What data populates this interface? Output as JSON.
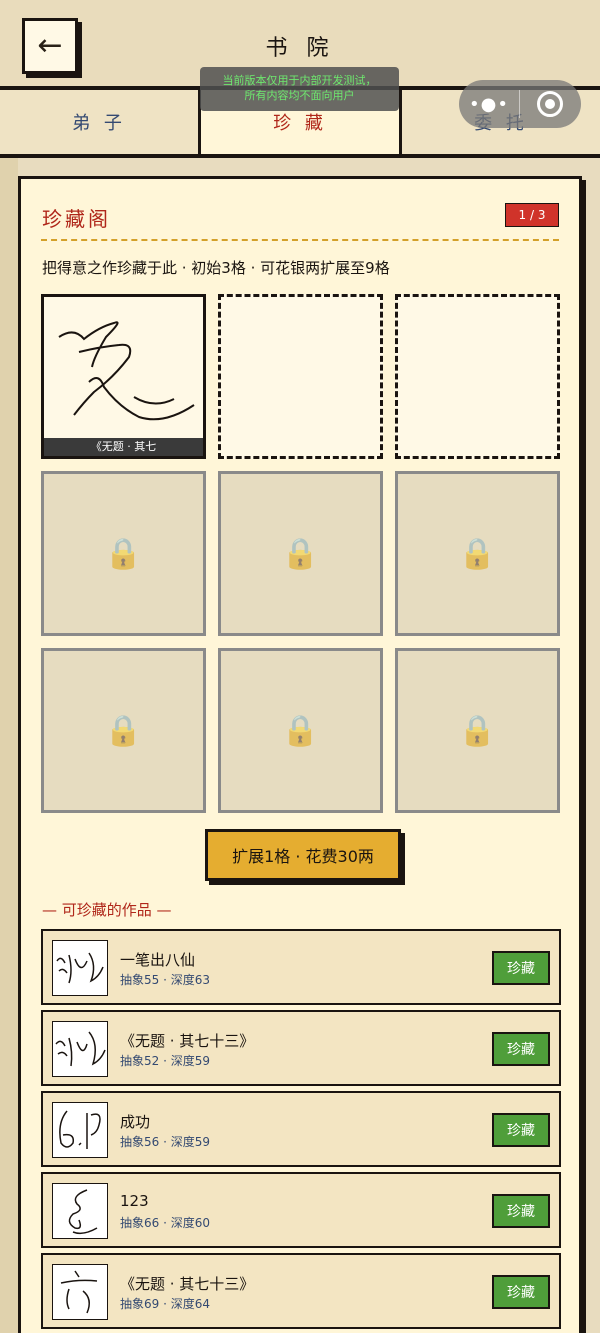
{
  "header": {
    "back_label": "←",
    "title": "书 院",
    "dev_notice_line1": "当前版本仅用于内部开发测试，",
    "dev_notice_line2": "所有内容均不面向用户"
  },
  "capsule": {
    "more": "•●•"
  },
  "tabs": [
    {
      "label": "弟 子"
    },
    {
      "label": "珍 藏"
    },
    {
      "label": "委 托"
    }
  ],
  "collection": {
    "title": "珍藏阁",
    "page_badge": "1 / 3",
    "description": "把得意之作珍藏于此 · 初始3格 · 可花银两扩展至9格",
    "filled_caption": "《无题 · 其七",
    "lock_glyph": "🔒",
    "expand_label": "扩展1格 · 花费30两"
  },
  "works_section": {
    "heading": "— 可珍藏的作品 —",
    "save_label": "珍藏",
    "items": [
      {
        "name": "一笔出八仙",
        "stats": "抽象55 · 深度63"
      },
      {
        "name": "《无题 · 其七十三》",
        "stats": "抽象52 · 深度59"
      },
      {
        "name": "成功",
        "stats": "抽象56 · 深度59"
      },
      {
        "name": "123",
        "stats": "抽象66 · 深度60"
      },
      {
        "name": "《无题 · 其七十三》",
        "stats": "抽象69 · 深度64"
      }
    ]
  },
  "colors": {
    "accent_red": "#b0271a",
    "expand_yellow": "#e5ad30",
    "save_green": "#4f9e3a"
  }
}
